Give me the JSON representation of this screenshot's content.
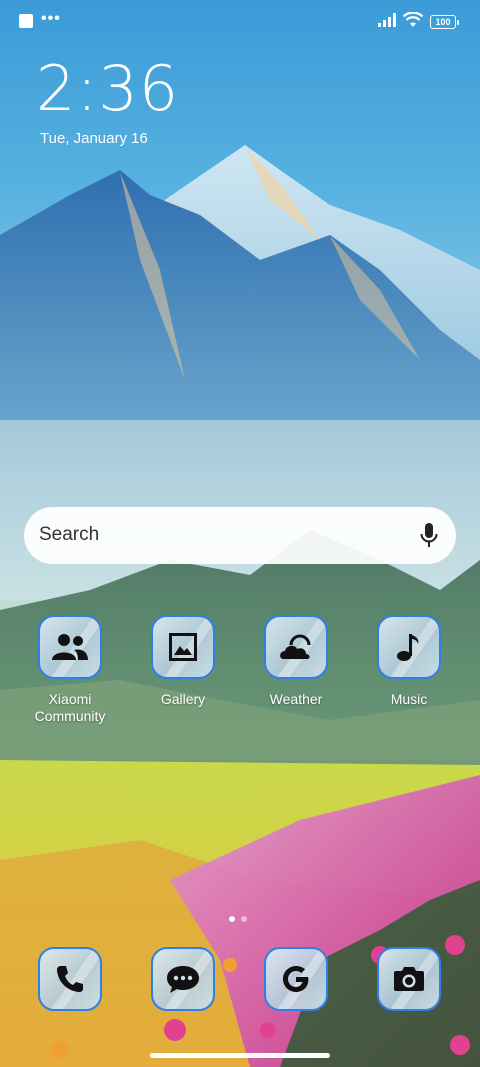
{
  "status_bar": {
    "dots": "•••",
    "battery_level": "100"
  },
  "lock": {
    "time": "2:36",
    "date": "Tue, January 16"
  },
  "search": {
    "placeholder": "Search",
    "mic_icon": "microphone-icon"
  },
  "apps": [
    {
      "label": "Xiaomi\nCommunity",
      "icon": "community-people-icon"
    },
    {
      "label": "Gallery",
      "icon": "gallery-image-icon"
    },
    {
      "label": "Weather",
      "icon": "weather-cloud-sun-icon"
    },
    {
      "label": "Music",
      "icon": "music-note-icon"
    }
  ],
  "dock": [
    {
      "icon": "phone-icon"
    },
    {
      "icon": "messages-icon"
    },
    {
      "icon": "google-icon"
    },
    {
      "icon": "camera-icon"
    }
  ],
  "pager": {
    "pages": 2,
    "active": 0
  },
  "colors": {
    "icon_border": "#2f7fe6",
    "text": "#ffffff"
  }
}
